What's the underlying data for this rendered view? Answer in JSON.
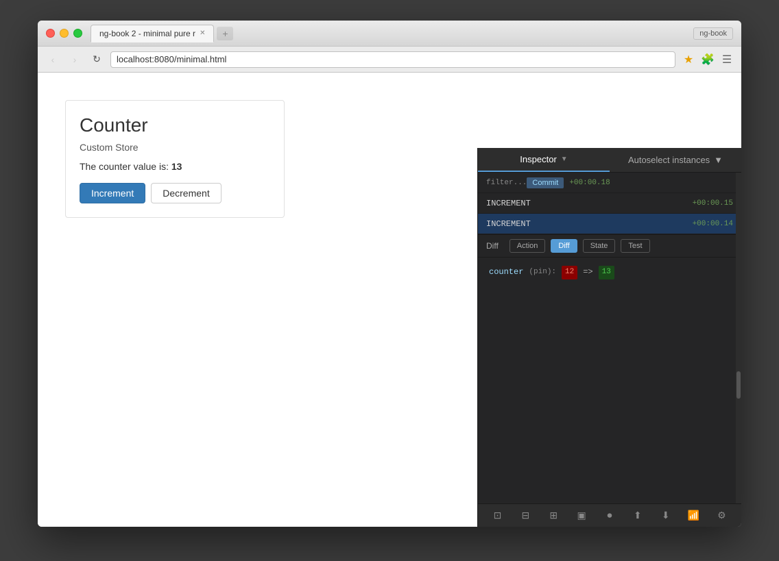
{
  "browser": {
    "tab_title": "ng-book 2 - minimal pure r",
    "url": "localhost:8080/minimal.html",
    "window_label": "ng-book",
    "new_tab_placeholder": "+"
  },
  "counter_app": {
    "title": "Counter",
    "subtitle": "Custom Store",
    "value_label": "The counter value is:",
    "value": "13",
    "increment_btn": "Increment",
    "decrement_btn": "Decrement"
  },
  "devtools": {
    "inspector_label": "Inspector",
    "autoselect_label": "Autoselect instances",
    "actions": [
      {
        "name": "filter...",
        "time": "",
        "commit": true
      },
      {
        "name": "INCREMENT",
        "time": "+00:00.18",
        "commit": true
      },
      {
        "name": "INCREMENT",
        "time": "+00:00.15",
        "commit": false
      },
      {
        "name": "INCREMENT",
        "time": "+00:00.14",
        "commit": false
      }
    ],
    "diff_section": {
      "label": "Diff",
      "tabs": [
        "Action",
        "Diff",
        "State",
        "Test"
      ],
      "active_tab": "Diff",
      "diff_key": "counter",
      "diff_pin": "(pin):",
      "diff_old": "12",
      "diff_arrow": "=>",
      "diff_new": "13"
    },
    "toolbar_icons": [
      "⊞",
      "⊟",
      "⊠",
      "▶",
      "⏺",
      "⬆",
      "⬇",
      "📊",
      "⚙"
    ]
  }
}
